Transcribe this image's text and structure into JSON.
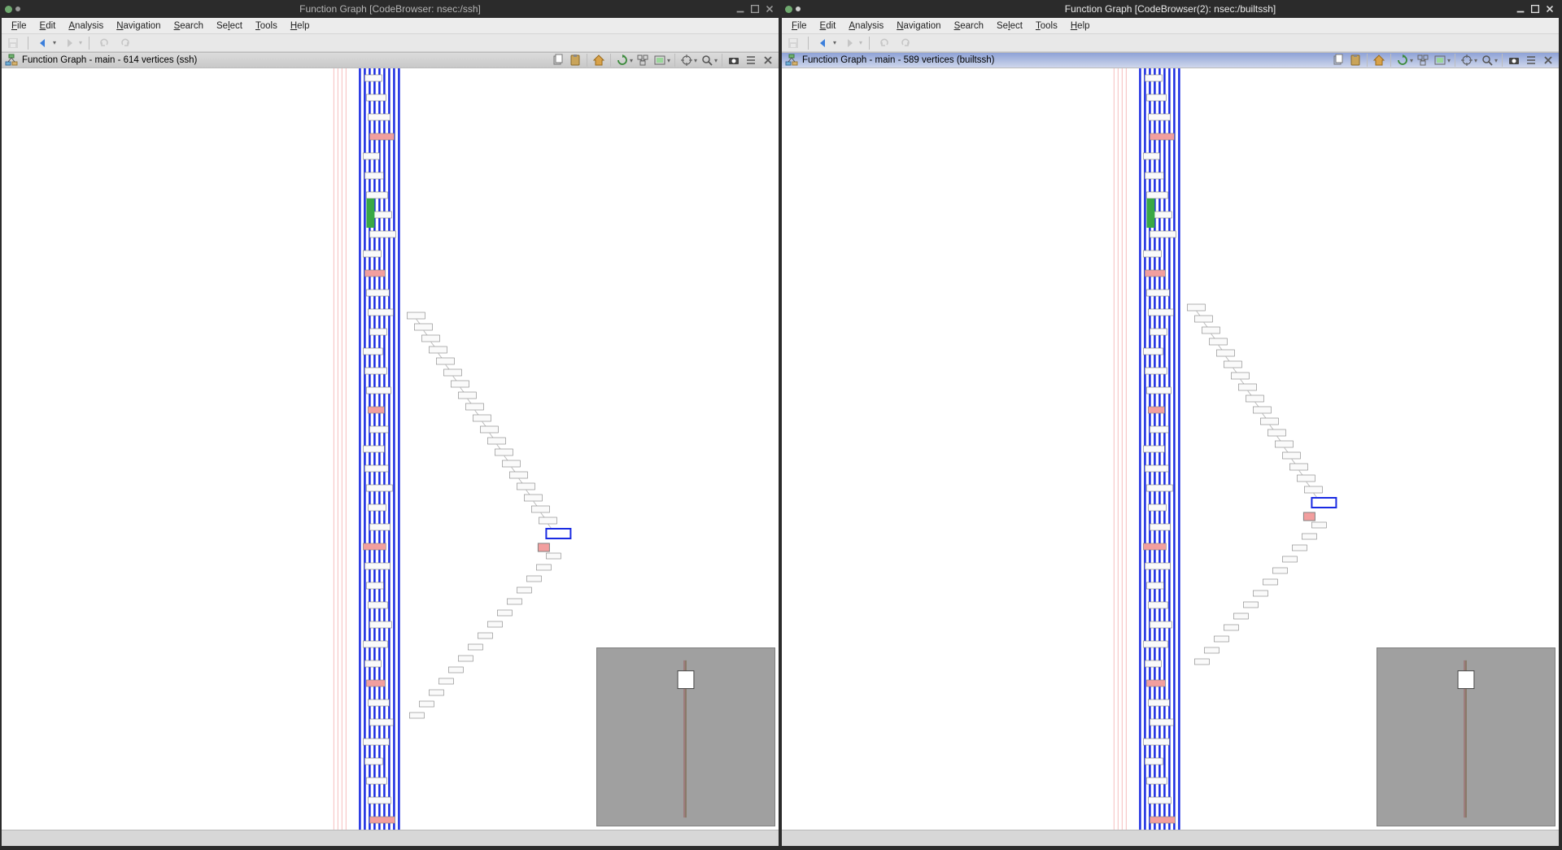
{
  "windows": [
    {
      "key": "left",
      "active": false,
      "title": "Function Graph [CodeBrowser: nsec:/ssh]",
      "pane_title": "Function Graph - main - 614 vertices  (ssh)",
      "pane_active": false
    },
    {
      "key": "right",
      "active": true,
      "title": "Function Graph [CodeBrowser(2): nsec:/builtssh]",
      "pane_title": "Function Graph - main - 589 vertices  (builtssh)",
      "pane_active": true
    }
  ],
  "menu": [
    "File",
    "Edit",
    "Analysis",
    "Navigation",
    "Search",
    "Select",
    "Tools",
    "Help"
  ],
  "toolbar_icons": {
    "save": "save-icon",
    "back": "arrow-left-icon",
    "forward": "arrow-right-icon",
    "undo": "undo-icon",
    "redo": "redo-icon"
  },
  "pane_toolbar_icons": {
    "copy": "copy-icon",
    "paste": "paste-icon",
    "home": "home-icon",
    "refresh": "refresh-cycle-icon",
    "nested": "nested-layout-icon",
    "screenshot": "screenshot-icon",
    "goto": "crosshair-icon",
    "edit": "edit-icon",
    "snapshot": "camera-icon",
    "menu": "hamburger-menu-icon",
    "close": "close-icon"
  },
  "window_controls": {
    "min": "minimize-icon",
    "max": "maximize-icon",
    "close": "close-icon"
  },
  "colors": {
    "edge_blue": "#1a2be2",
    "edge_pink": "#f2a6a6",
    "node_fill": "#fafafa",
    "node_border": "#808080",
    "node_pink": "#f29e9e",
    "node_green": "#39a845"
  }
}
